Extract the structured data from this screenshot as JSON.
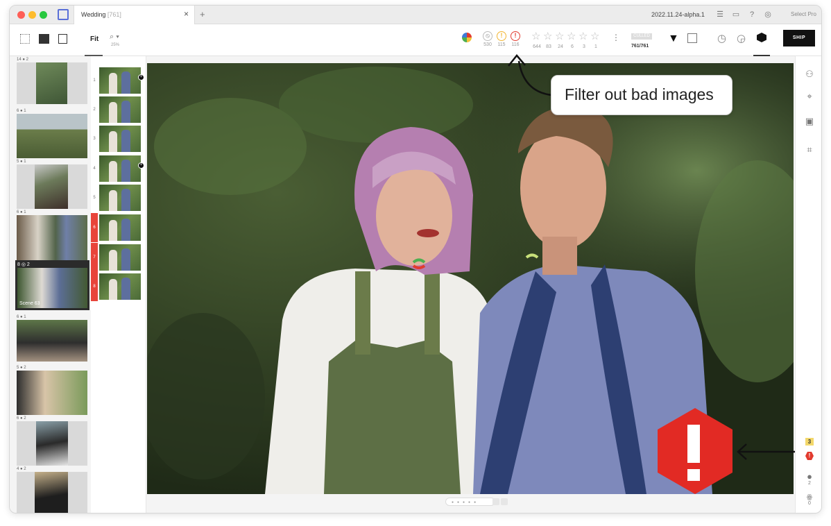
{
  "window": {
    "tab_title": "Wedding",
    "tab_count": "[761]",
    "version": "2022.11.24-alpha.1",
    "select_pro": "Select Pro"
  },
  "toolbar": {
    "fit_label": "Fit",
    "zoom_percent": "25%"
  },
  "flags": [
    {
      "icon": "rejected-icon",
      "count": "530"
    },
    {
      "icon": "warning-icon",
      "count": "115"
    },
    {
      "icon": "error-icon",
      "count": "116"
    }
  ],
  "stars": [
    "644",
    "83",
    "24",
    "6",
    "3",
    "1"
  ],
  "cull": {
    "label": "CULLED",
    "count": "761/761"
  },
  "ship_label": "SHIP",
  "scenes": [
    {
      "meta": "14 ● 2"
    },
    {
      "meta": "6 ● 1"
    },
    {
      "meta": "5 ● 1"
    },
    {
      "meta": "6 ● 1"
    },
    {
      "meta": "8 ◎ 2",
      "label": "Scene 63",
      "active": true
    },
    {
      "meta": "6 ● 1"
    },
    {
      "meta": "5 ● 2"
    },
    {
      "meta": "6 ● 2"
    },
    {
      "meta": "4 ● 2"
    }
  ],
  "strip": [
    {
      "num": "1",
      "bad": false
    },
    {
      "num": "2",
      "bad": false
    },
    {
      "num": "3",
      "bad": false
    },
    {
      "num": "4",
      "bad": false
    },
    {
      "num": "5",
      "bad": false
    },
    {
      "num": "6",
      "bad": true
    },
    {
      "num": "7",
      "bad": true
    },
    {
      "num": "8",
      "bad": true
    }
  ],
  "rightbar": {
    "warning_count": "3",
    "error_icon": "!",
    "person_count": "2",
    "group_count": "0"
  },
  "callout": {
    "text": "Filter out bad images"
  },
  "colors": {
    "accent": "#e22a24",
    "warning": "#f3d86b",
    "ship": "#111111"
  }
}
